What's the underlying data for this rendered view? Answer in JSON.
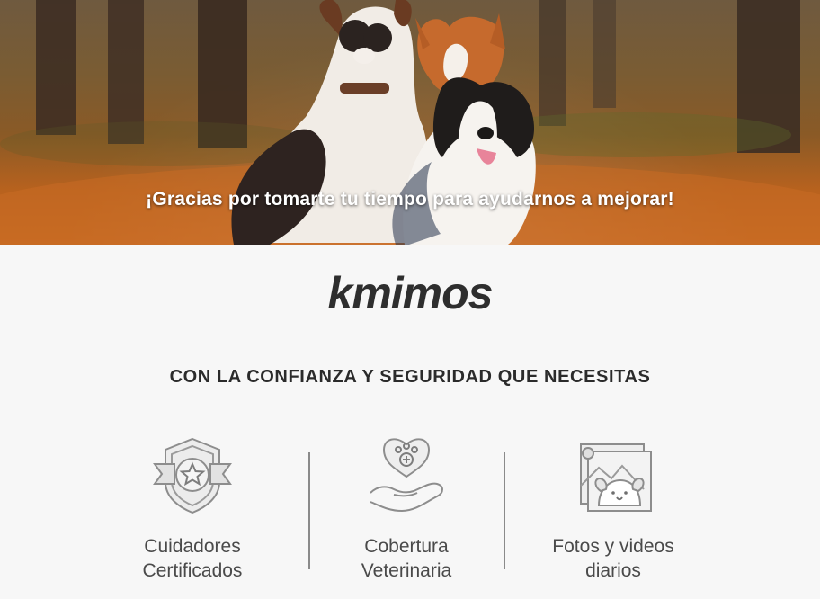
{
  "hero": {
    "headline": "¡Gracias por tomarte tu tiempo para ayudarnos a mejorar!"
  },
  "brand": {
    "logo_text": "kmimos"
  },
  "tagline": "CON LA CONFIANZA Y SEGURIDAD QUE NECESITAS",
  "features": [
    {
      "icon": "badge-star-icon",
      "label": "Cuidadores\nCertificados"
    },
    {
      "icon": "hand-heart-paw-icon",
      "label": "Cobertura\nVeterinaria"
    },
    {
      "icon": "photo-dog-icon",
      "label": "Fotos y videos\ndiarios"
    }
  ]
}
